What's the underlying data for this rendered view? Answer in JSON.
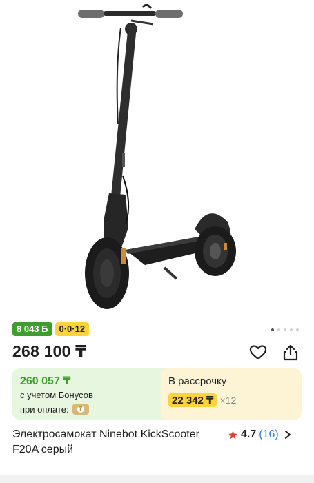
{
  "product": {
    "image_alt": "Ninebot KickScooter F20A",
    "name": "Электросамокат Ninebot KickScooter F20A серый"
  },
  "badges": {
    "bonus": "8 043 Б",
    "installment_plan": "0·0·12"
  },
  "gallery": {
    "pages": 5,
    "current": 1
  },
  "price": {
    "value": "268 100 ₸"
  },
  "actions": {
    "favorite_icon": "heart-icon",
    "share_icon": "share-icon"
  },
  "bonus_card": {
    "amount": "260 057 ₸",
    "line1": "с учетом Бонусов",
    "line2": "при оплате:"
  },
  "installment_card": {
    "title": "В рассрочку",
    "amount": "22 342 ₸",
    "multiplier": "×12"
  },
  "rating": {
    "value": "4.7",
    "count": "(16)"
  },
  "colors": {
    "green": "#3f9d2f",
    "yellow": "#ffd43b",
    "bonus_bg": "#e6f6df",
    "installment_bg": "#fdf4d5",
    "link": "#2f7ad6",
    "star": "#e2402f"
  }
}
